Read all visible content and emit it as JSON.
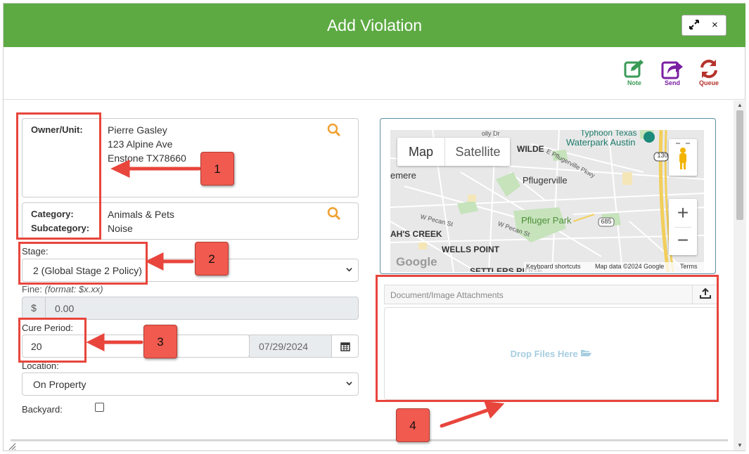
{
  "dialog": {
    "title": "Add Violation",
    "expand_icon": "expand-icon",
    "close_label": "×"
  },
  "toolbar": {
    "note_label": "Note",
    "send_label": "Send",
    "queue_label": "Queue",
    "note_color": "#3a9b56",
    "send_color": "#7a1fa2",
    "queue_color": "#b5322c"
  },
  "owner": {
    "label": "Owner/Unit:",
    "name": "Pierre Gasley",
    "address1": "123 Alpine Ave",
    "address2": "Enstone TX78660"
  },
  "category": {
    "category_label": "Category:",
    "subcategory_label": "Subcategory:",
    "category_value": "Animals & Pets",
    "subcategory_value": "Noise"
  },
  "stage": {
    "label": "Stage:",
    "value": "2 (Global Stage 2 Policy)"
  },
  "fine": {
    "label": "Fine:",
    "hint": "(format: $x.xx)",
    "currency": "$",
    "value": "0.00"
  },
  "cure": {
    "label": "Cure Period:",
    "value": "20",
    "date": "07/29/2024"
  },
  "location": {
    "label": "Location:",
    "value": "On Property"
  },
  "backyard": {
    "label": "Backyard:",
    "checked": false
  },
  "map": {
    "map_tab": "Map",
    "satellite_tab": "Satellite",
    "labels": {
      "pflugerville": "Pflugerville",
      "pfluger_park": "Pfluger Park",
      "wilde": "WILDE",
      "wells_point": "WELLS POINT",
      "ahs_creek": "AH'S CREEK",
      "emere": "emere",
      "settlers": "SETTLERS RIDGE",
      "typhoon": "Typhoon Texas",
      "waterpark": "Waterpark Austin",
      "pecan1": "W Pecan St",
      "pecan2": "W Pecan St",
      "pkwy": "E Pflugerville Pkwy",
      "hwy130": "130",
      "hwy685": "685",
      "dolly": "olly Dr"
    },
    "footer_shortcuts": "Keyboard shortcuts",
    "footer_data": "Map data ©2024 Google",
    "footer_terms": "Terms",
    "logo": "Google",
    "zoom_in": "+",
    "zoom_out": "−"
  },
  "attachments": {
    "header": "Document/Image Attachments",
    "drop_text": "Drop Files Here"
  },
  "annotations": {
    "badge1": "1",
    "badge2": "2",
    "badge3": "3",
    "badge4": "4",
    "color": "#e8453c"
  }
}
